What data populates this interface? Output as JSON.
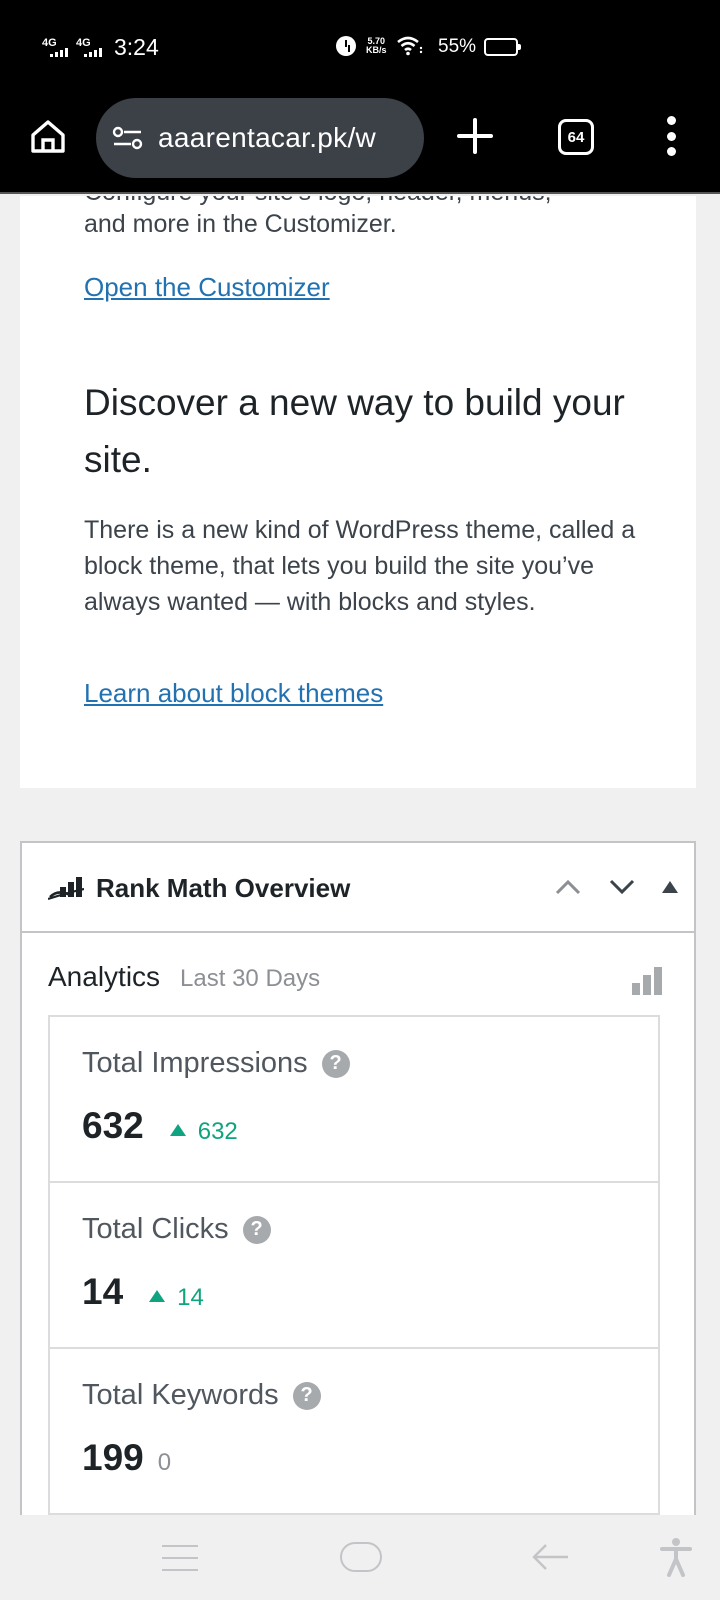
{
  "status_bar": {
    "network1": "4G",
    "network2": "4G",
    "time": "3:24",
    "speed_value": "5.70",
    "speed_unit": "KB/s",
    "battery_percent": "55%",
    "battery_level": 0.55
  },
  "browser": {
    "url": "aaarentacar.pk/w",
    "tab_count": "64"
  },
  "customizer_card": {
    "cut_text": "Configure your site's logo, header, menus,",
    "text": "and more in the Customizer.",
    "link": "Open the Customizer",
    "heading": "Discover a new way to build your site.",
    "paragraph": "There is a new kind of WordPress theme, called a block theme, that lets you build the site you’ve always wanted — with blocks and styles.",
    "block_link": "Learn about block themes"
  },
  "rank_math": {
    "title": "Rank Math Overview",
    "analytics_title": "Analytics",
    "period": "Last 30 Days",
    "stats": [
      {
        "label": "Total Impressions",
        "value": "632",
        "delta": "632",
        "trend": "up"
      },
      {
        "label": "Total Clicks",
        "value": "14",
        "delta": "14",
        "trend": "up"
      },
      {
        "label": "Total Keywords",
        "value": "199",
        "delta": "0",
        "trend": "none"
      }
    ]
  },
  "icons": {
    "home": "home-icon",
    "site_settings": "tune-icon",
    "new_tab": "plus-icon",
    "tabs": "tab-switcher-icon",
    "menu": "more-vert-icon",
    "rank_math": "rank-math-logo-icon",
    "help": "help-icon",
    "analytics": "bar-chart-icon"
  },
  "colors": {
    "link": "#2271b1",
    "positive": "#10a37f",
    "muted": "#8c8f94"
  }
}
